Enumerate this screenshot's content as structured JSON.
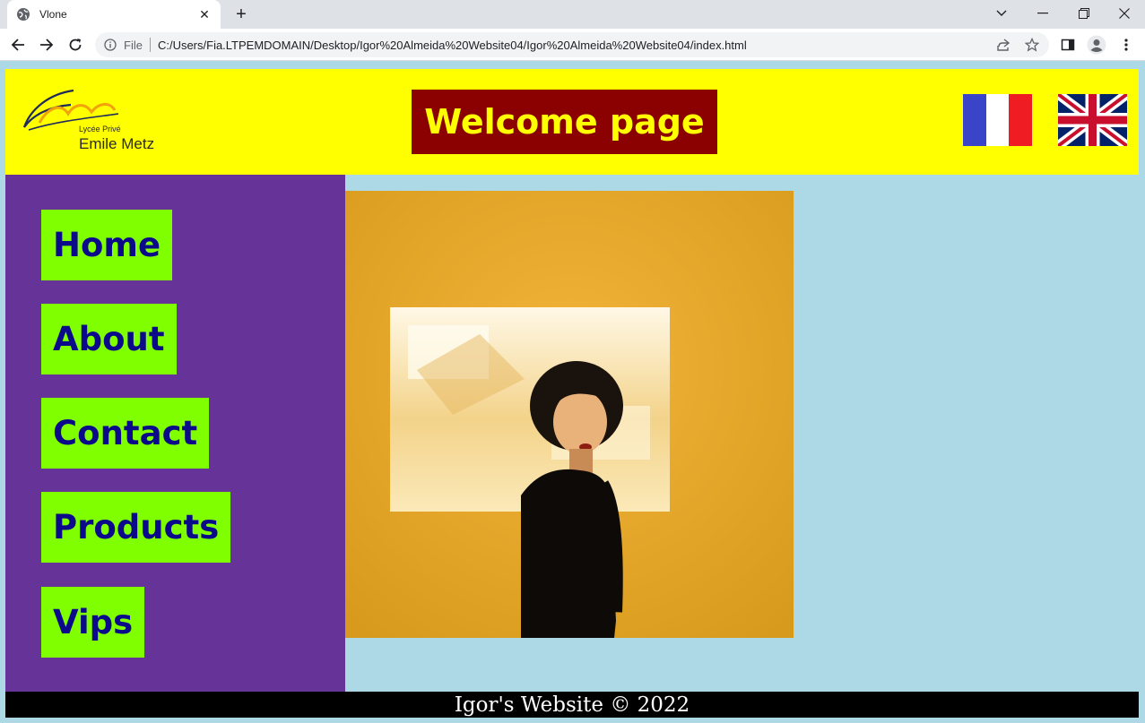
{
  "browser": {
    "tab_title": "Vlone",
    "new_tab": "+",
    "scheme_label": "File",
    "url": "C:/Users/Fia.LTPEMDOMAIN/Desktop/Igor%20Almeida%20Website04/Igor%20Almeida%20Website04/index.html"
  },
  "header": {
    "logo_line1": "Lycée Privé",
    "logo_line2": "Emile Metz",
    "title": "Welcome page",
    "flags": [
      "french-flag",
      "uk-flag"
    ]
  },
  "nav": {
    "items": [
      {
        "label": "Home"
      },
      {
        "label": "About"
      },
      {
        "label": "Contact"
      },
      {
        "label": "Products"
      },
      {
        "label": "Vips"
      }
    ]
  },
  "footer": {
    "text": "Igor's Website © 2022"
  },
  "colors": {
    "header_bg": "#ffff00",
    "title_bg": "#8b0000",
    "title_fg": "#ffff00",
    "sidebar_bg": "#663399",
    "nav_bg": "#7fff00",
    "nav_fg": "#0a0a8a",
    "page_bg": "#add8e6",
    "footer_bg": "#000000"
  }
}
